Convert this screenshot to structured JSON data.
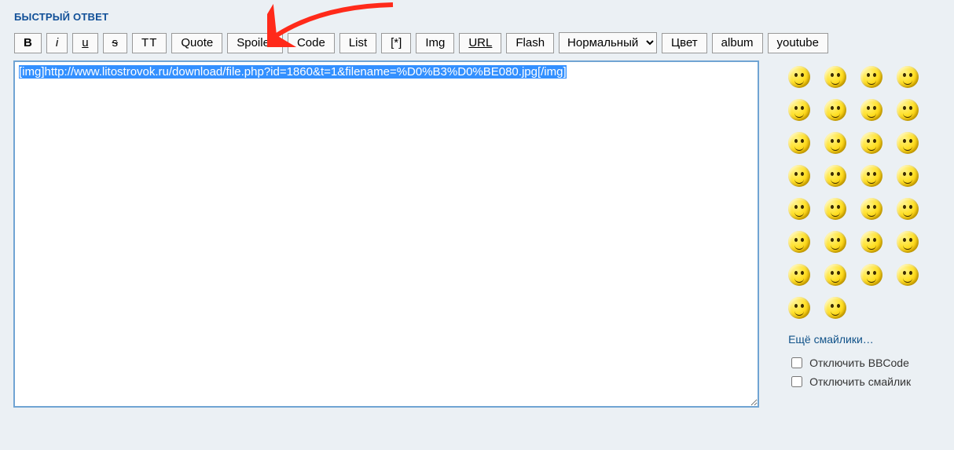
{
  "panel": {
    "title": "БЫСТРЫЙ ОТВЕТ"
  },
  "toolbar": {
    "bold": "B",
    "italic": "i",
    "underline": "u",
    "strike": "s",
    "tt": "TT",
    "quote": "Quote",
    "spoiler": "Spoiler",
    "code": "Code",
    "list": "List",
    "list_item": "[*]",
    "img": "Img",
    "url": "URL",
    "flash": "Flash",
    "font_size_selected": "Нормальный",
    "color": "Цвет",
    "album": "album",
    "youtube": "youtube"
  },
  "editor": {
    "content": "[img]http://www.litostrovok.ru/download/file.php?id=1860&t=1&filename=%D0%B3%D0%BE080.jpg[/img]"
  },
  "smilies": {
    "more_link": "Ещё смайлики…",
    "items": [
      "pirate",
      "blush",
      "hmm",
      "smile",
      "hearts",
      "bored",
      "cool",
      "grin",
      "dizzy",
      "wink",
      "teeth",
      "wow",
      "thumbs",
      "sweat",
      "wave",
      "frown",
      "laugh",
      "shades",
      "money",
      "angel",
      "clap",
      "party",
      "cheer",
      "sleepy",
      "ok",
      "sun",
      "thumbsup",
      "tongue",
      "crazy",
      "dance"
    ]
  },
  "options": {
    "disable_bbcode": "Отключить BBCode",
    "disable_smilies": "Отключить смайлик"
  }
}
